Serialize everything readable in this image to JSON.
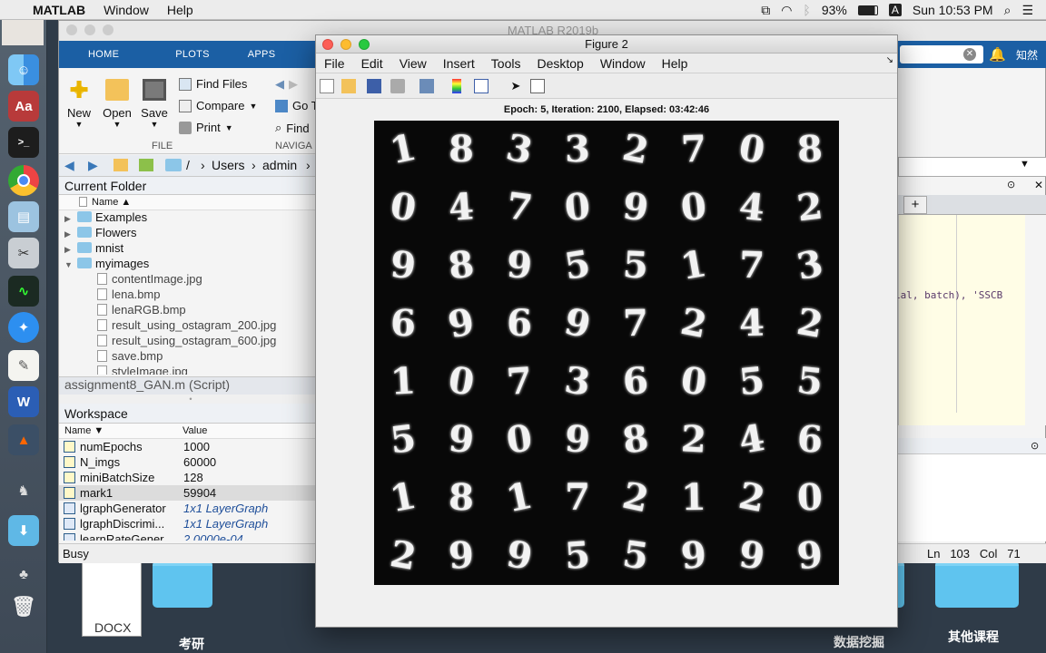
{
  "menubar": {
    "app": "MATLAB",
    "items": [
      "Window",
      "Help"
    ],
    "battery": "93%",
    "input": "A",
    "clock": "Sun 10:53 PM"
  },
  "desktop": {
    "doc_label": "DOCX",
    "labels": [
      "考研",
      "数据挖掘",
      "其他课程"
    ],
    "top_right_text": "知然"
  },
  "matlab": {
    "title": "MATLAB R2019b",
    "tabs": [
      "HOME",
      "PLOTS",
      "APPS"
    ],
    "buttons": {
      "new": "New",
      "open": "Open",
      "save": "Save",
      "find_files": "Find Files",
      "compare": "Compare",
      "print": "Print",
      "goto": "Go T",
      "find": "Find"
    },
    "sections": {
      "file": "FILE",
      "navigate": "NAVIGA"
    },
    "path": [
      "/",
      "Users",
      "admin"
    ],
    "current_folder": {
      "title": "Current Folder",
      "col_name": "Name ▲",
      "folders": [
        "Examples",
        "Flowers",
        "mnist",
        "myimages"
      ],
      "files": [
        "contentImage.jpg",
        "lena.bmp",
        "lenaRGB.bmp",
        "result_using_ostagram_200.jpg",
        "result_using_ostagram_600.jpg",
        "save.bmp",
        "styleImage.jpg"
      ]
    },
    "script_label": "assignment8_GAN.m  (Script)",
    "workspace": {
      "title": "Workspace",
      "col_name": "Name ▼",
      "col_value": "Value",
      "rows": [
        {
          "name": "numEpochs",
          "value": "1000"
        },
        {
          "name": "N_imgs",
          "value": "60000"
        },
        {
          "name": "miniBatchSize",
          "value": "128"
        },
        {
          "name": "mark1",
          "value": "59904"
        },
        {
          "name": "lgraphGenerator",
          "value": "1x1 LayerGraph"
        },
        {
          "name": "lgraphDiscrimi...",
          "value": "1x1 LayerGraph"
        },
        {
          "name": "learnRateGener...",
          "value": "2.0000e-04"
        }
      ]
    },
    "status": "Busy",
    "editor_snippet": "ial, batch), 'SSCB",
    "cursor": {
      "ln_label": "Ln",
      "ln": "103",
      "col_label": "Col",
      "col": "71"
    }
  },
  "figure": {
    "title": "Figure 2",
    "menu": [
      "File",
      "Edit",
      "View",
      "Insert",
      "Tools",
      "Desktop",
      "Window",
      "Help"
    ],
    "plot_title": "Epoch: 5, Iteration: 2100, Elapsed: 03:42:46",
    "digits": [
      "1",
      "8",
      "3",
      "3",
      "2",
      "7",
      "0",
      "8",
      "0",
      "4",
      "7",
      "0",
      "9",
      "0",
      "4",
      "2",
      "9",
      "8",
      "9",
      "5",
      "5",
      "1",
      "7",
      "3",
      "6",
      "9",
      "6",
      "9",
      "7",
      "2",
      "4",
      "2",
      "1",
      "0",
      "7",
      "3",
      "6",
      "0",
      "5",
      "5",
      "5",
      "9",
      "0",
      "9",
      "8",
      "2",
      "4",
      "6",
      "1",
      "8",
      "1",
      "7",
      "2",
      "1",
      "2",
      "0",
      "2",
      "9",
      "9",
      "5",
      "5",
      "9",
      "9",
      "9"
    ]
  }
}
